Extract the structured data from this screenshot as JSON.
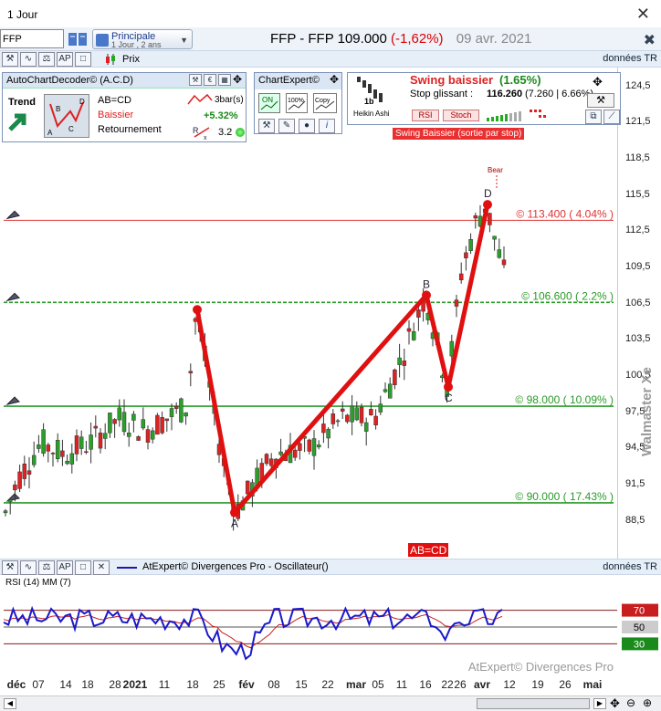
{
  "window": {
    "title": "1 Jour",
    "close_glyph": "✕"
  },
  "toolbar": {
    "symbol_value": "FFP",
    "layout_name": "Principale",
    "layout_sub": "1 Jour , 2 ans",
    "quote_name": "FFP - FFP",
    "quote_price": "109.000",
    "quote_change": "(-1,62%)",
    "quote_date": "09 avr. 2021"
  },
  "price_panel": {
    "series_label": "Prix",
    "data_label": "données TR"
  },
  "acd": {
    "title": "AutoChartDecoder© (A.C.D)",
    "trend_label": "Trend",
    "pattern": "AB=CD",
    "direction": "Baissier",
    "state": "Retournement",
    "bars": "3bar(s)",
    "pct": "+5.32%",
    "score": "3.2"
  },
  "chartexpert": {
    "title": "ChartExpert©"
  },
  "swing": {
    "title": "Swing baissier",
    "title_pct": "(1.65%)",
    "stop_label": "Stop glissant :",
    "stop_value": "116.260",
    "stop_extra": "(7.260 | 6.66%)",
    "rsi_btn": "RSI",
    "stoch_btn": "Stoch",
    "heikin": "Heikin Ashi",
    "tag": "Swing Baissier (sortie par stop)",
    "bear": "Bear"
  },
  "levels": [
    {
      "label": "© 113.400 ( 4.04% )",
      "price": 113.4,
      "color": "#d33"
    },
    {
      "label": "© 106.600 ( 2.2% )",
      "price": 106.6,
      "color": "#2a9a2a"
    },
    {
      "label": "© 98.000 ( 10.09% )",
      "price": 98.0,
      "color": "#2a9a2a"
    },
    {
      "label": "© 90.000 ( 17.43% )",
      "price": 90.0,
      "color": "#2a9a2a"
    }
  ],
  "price_ticks": [
    "124,5",
    "121,5",
    "118,5",
    "115,5",
    "112,5",
    "109,5",
    "106,5",
    "103,5",
    "100,5",
    "97,5",
    "94,5",
    "91,5",
    "88,5"
  ],
  "pattern_points": [
    {
      "label": "",
      "idx": 0,
      "price": 106
    },
    {
      "label": "A",
      "idx": 1,
      "price": 89.2
    },
    {
      "label": "B",
      "idx": 2,
      "price": 107.2
    },
    {
      "label": "C",
      "idx": 3,
      "price": 99.6
    },
    {
      "label": "D",
      "idx": 4,
      "price": 114.7
    }
  ],
  "pattern_tag": "AB=CD",
  "watermark": "Walmaster Xe",
  "oscillator": {
    "title": "AtExpert© Divergences Pro - Oscillateur()",
    "data_label": "données TR",
    "rsi_label": "RSI (14) MM (7)",
    "levels": [
      "70",
      "50",
      "30"
    ],
    "footer": "AtExpert© Divergences Pro"
  },
  "date_ticks": [
    "déc",
    "07",
    "14",
    "18",
    "28",
    "2021",
    "11",
    "18",
    "25",
    "fév",
    "08",
    "15",
    "22",
    "mar",
    "05",
    "11",
    "16",
    "22",
    "26",
    "avr",
    "12",
    "19",
    "26",
    "mai"
  ]
}
